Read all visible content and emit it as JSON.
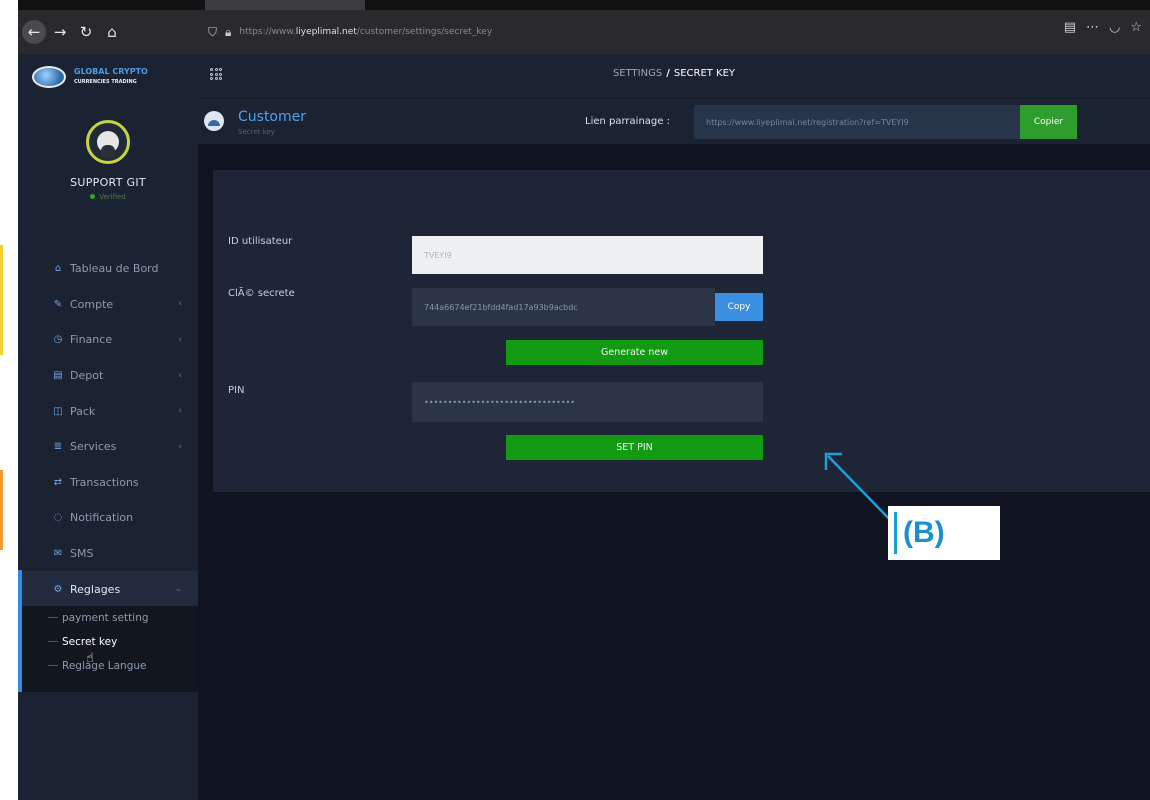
{
  "browser": {
    "url_prefix": "https://www.",
    "url_domain": "liyeplimal.net",
    "url_path": "/customer/settings/secret_key"
  },
  "brand": {
    "name_line1": "GLOBAL CRYPTO",
    "name_line2": "CURRENCIES TRADING"
  },
  "profile": {
    "name": "SUPPORT GIT",
    "status": "Verified"
  },
  "sidebar": {
    "items": [
      {
        "label": "Tableau de Bord",
        "icon": "home-icon",
        "glyph": "⌂",
        "has_children": false
      },
      {
        "label": "Compte",
        "icon": "user-icon",
        "glyph": "✎",
        "has_children": true
      },
      {
        "label": "Finance",
        "icon": "clock-icon",
        "glyph": "◷",
        "has_children": true
      },
      {
        "label": "Depot",
        "icon": "card-icon",
        "glyph": "▤",
        "has_children": true
      },
      {
        "label": "Pack",
        "icon": "package-icon",
        "glyph": "◫",
        "has_children": true
      },
      {
        "label": "Services",
        "icon": "list-icon",
        "glyph": "≣",
        "has_children": true
      },
      {
        "label": "Transactions",
        "icon": "exchange-icon",
        "glyph": "⇄",
        "has_children": false
      },
      {
        "label": "Notification",
        "icon": "chat-icon",
        "glyph": "◌",
        "has_children": false
      },
      {
        "label": "SMS",
        "icon": "mail-icon",
        "glyph": "✉",
        "has_children": false
      },
      {
        "label": "Reglages",
        "icon": "gear-icon",
        "glyph": "⚙",
        "has_children": true
      }
    ],
    "submenu": [
      "payment setting",
      "Secret key",
      "Reglage Langue"
    ]
  },
  "topbar": {
    "breadcrumb_root": "SETTINGS",
    "breadcrumb_sep": "/",
    "breadcrumb_current": "SECRET KEY"
  },
  "subheader": {
    "title": "Customer",
    "subtitle": "Secret key",
    "referral_label": "Lien parrainage :",
    "referral_link": "https://www.liyeplimal.net/registration?ref=TVEYI9",
    "copy_referral_button": "Copier"
  },
  "form": {
    "user_id_label": "ID utilisateur",
    "user_id_value": "TVEYI9",
    "secret_label": "ClÃ© secrete",
    "secret_value": "744a6674ef21bfdd4fad17a93b9acbdc",
    "copy_button": "Copy",
    "generate_button": "Generate new",
    "pin_label": "PIN",
    "pin_value": "••••••••••••••••••••••••••••••••",
    "set_pin_button": "SET PIN"
  },
  "annotation": {
    "label": "(B)",
    "color": "#1a8fd0"
  }
}
